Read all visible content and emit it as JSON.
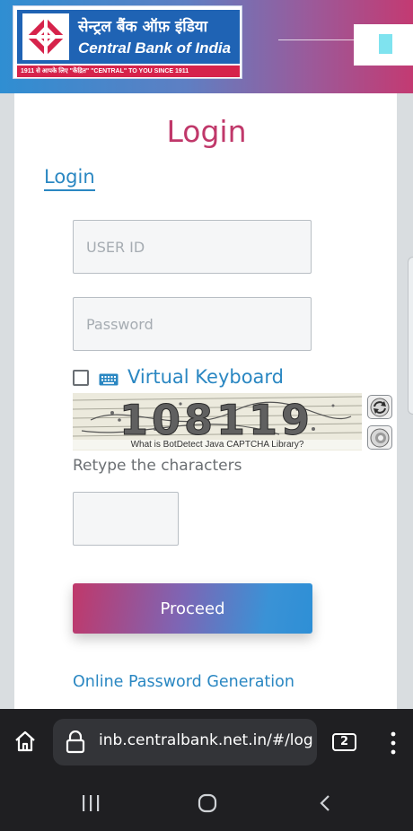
{
  "header": {
    "logo_hindi": "सेन्ट्रल बैंक ऑफ़ इंडिया",
    "logo_english": "Central Bank of India",
    "logo_tagline": "1911 से आपके लिए \"केंद्रित\"   \"CENTRAL\" TO YOU SINCE 1911",
    "colors": {
      "brand_blue": "#1f63b4",
      "brand_red": "#d6234b"
    }
  },
  "login": {
    "title": "Login",
    "tab_label": "Login",
    "user_id_placeholder": "USER ID",
    "password_placeholder": "Password",
    "virtual_keyboard_label": "Virtual Keyboard",
    "captcha_image_text": "108119",
    "captcha_caption": "What is BotDetect Java CAPTCHA Library?",
    "retype_label": "Retype the characters",
    "captcha_input_value": "",
    "proceed_label": "Proceed",
    "online_password_link": "Online Password Generation",
    "colors": {
      "title": "#c0386a",
      "link": "#2a87c2"
    }
  },
  "browser": {
    "url": "inb.centralbank.net.in/#/log",
    "tab_count": "2"
  },
  "icons": {
    "home": "home-icon",
    "lock": "lock-icon",
    "menu": "more-vert-icon",
    "keyboard": "keyboard-icon",
    "reload": "reload-icon",
    "sound": "speaker-icon"
  }
}
